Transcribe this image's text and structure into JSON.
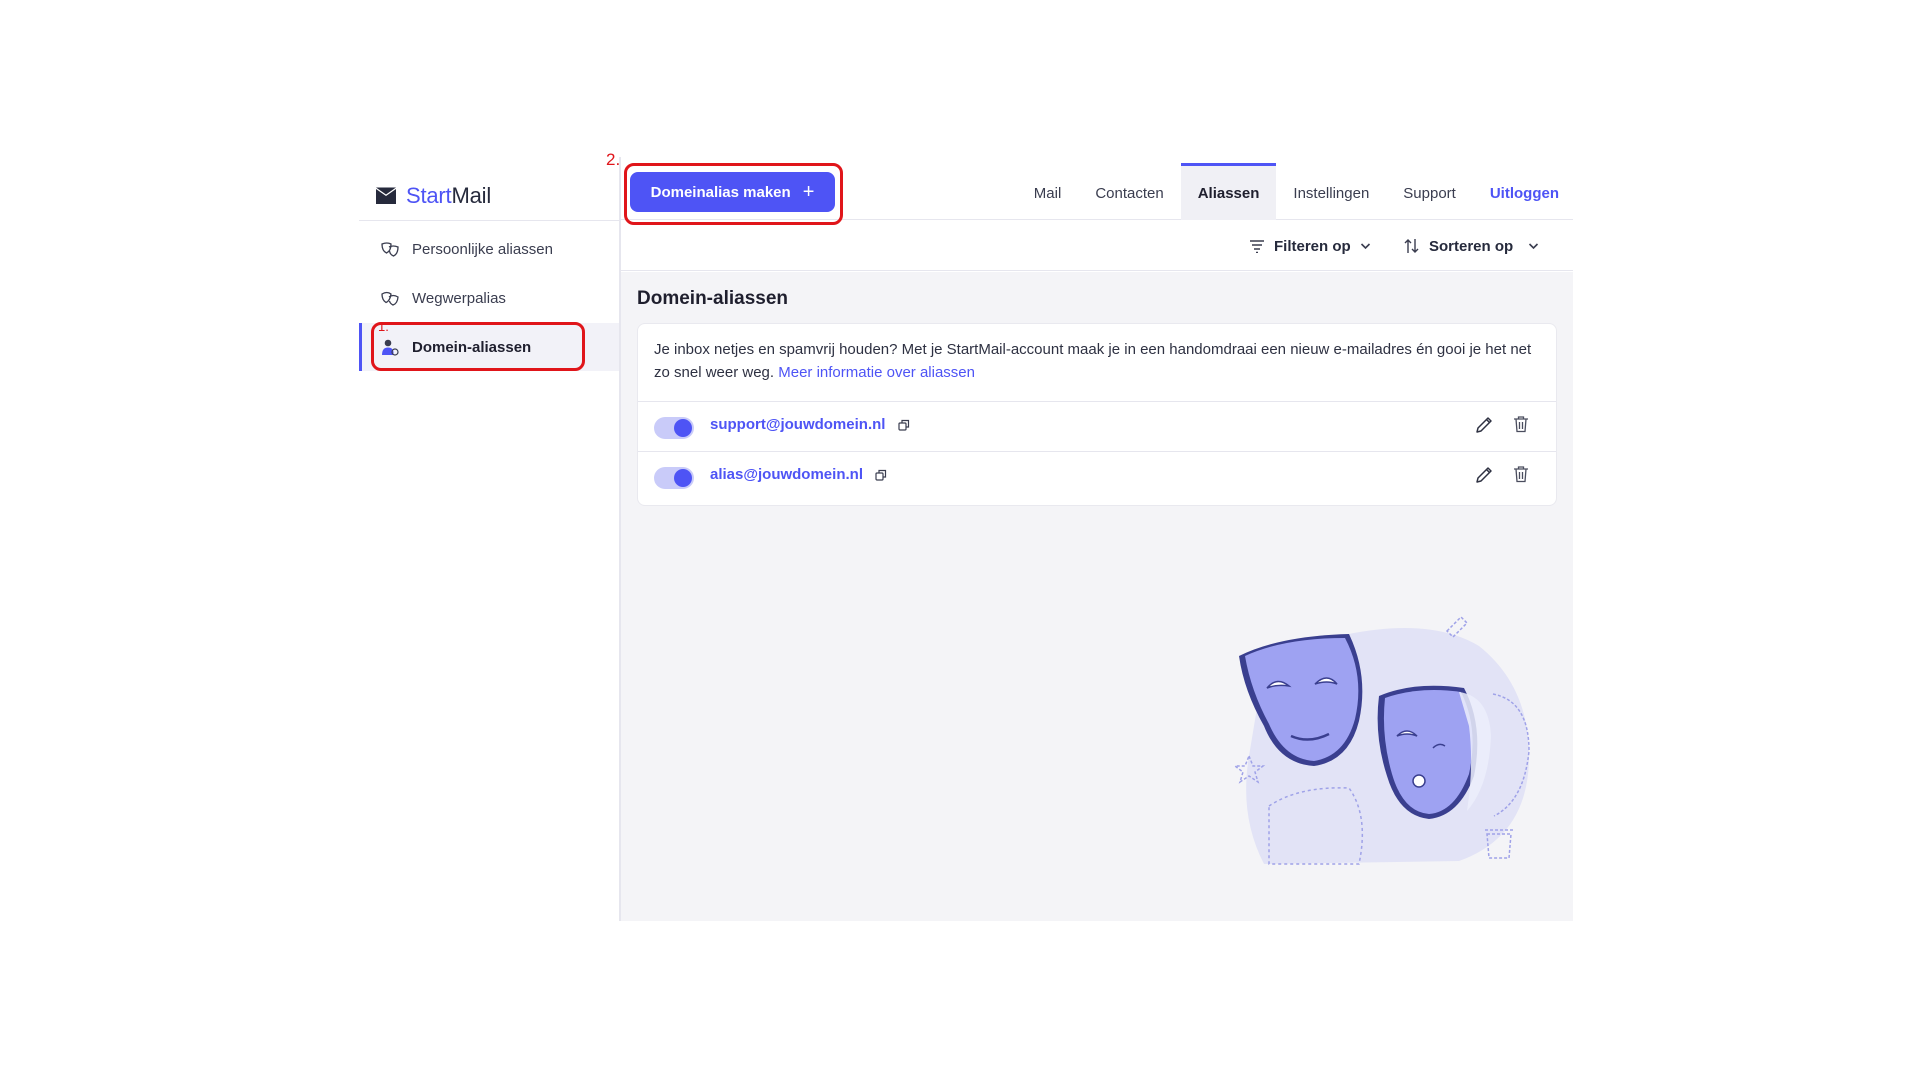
{
  "brand": {
    "start": "Start",
    "mail": "Mail"
  },
  "sidebar": {
    "items": [
      {
        "label": "Persoonlijke aliassen",
        "icon": "masks-icon"
      },
      {
        "label": "Wegwerpalias",
        "icon": "masks-icon"
      },
      {
        "label": "Domein-aliassen",
        "icon": "user-domain-icon",
        "active": true
      }
    ]
  },
  "header": {
    "create_label": "Domeinalias maken",
    "create_icon": "+",
    "tabs": [
      {
        "label": "Mail"
      },
      {
        "label": "Contacten"
      },
      {
        "label": "Aliassen",
        "active": true
      },
      {
        "label": "Instellingen"
      },
      {
        "label": "Support"
      }
    ],
    "logout_label": "Uitloggen"
  },
  "toolbar": {
    "filter_label": "Filteren op",
    "sort_label": "Sorteren op"
  },
  "main": {
    "title": "Domein-aliassen",
    "intro_text": "Je inbox netjes en spamvrij houden? Met je StartMail-account maak je in een handomdraai een nieuw e-mailadres én gooi je het net zo snel weer weg. ",
    "intro_link": "Meer informatie over aliassen",
    "aliases": [
      {
        "address": "support@jouwdomein.nl",
        "enabled": true
      },
      {
        "address": "alias@jouwdomein.nl",
        "enabled": true
      }
    ]
  },
  "annotations": {
    "step1": "1.",
    "step2": "2."
  },
  "colors": {
    "accent": "#4e54f5",
    "annotation": "#e0151a",
    "content_bg": "#f4f4f7"
  }
}
